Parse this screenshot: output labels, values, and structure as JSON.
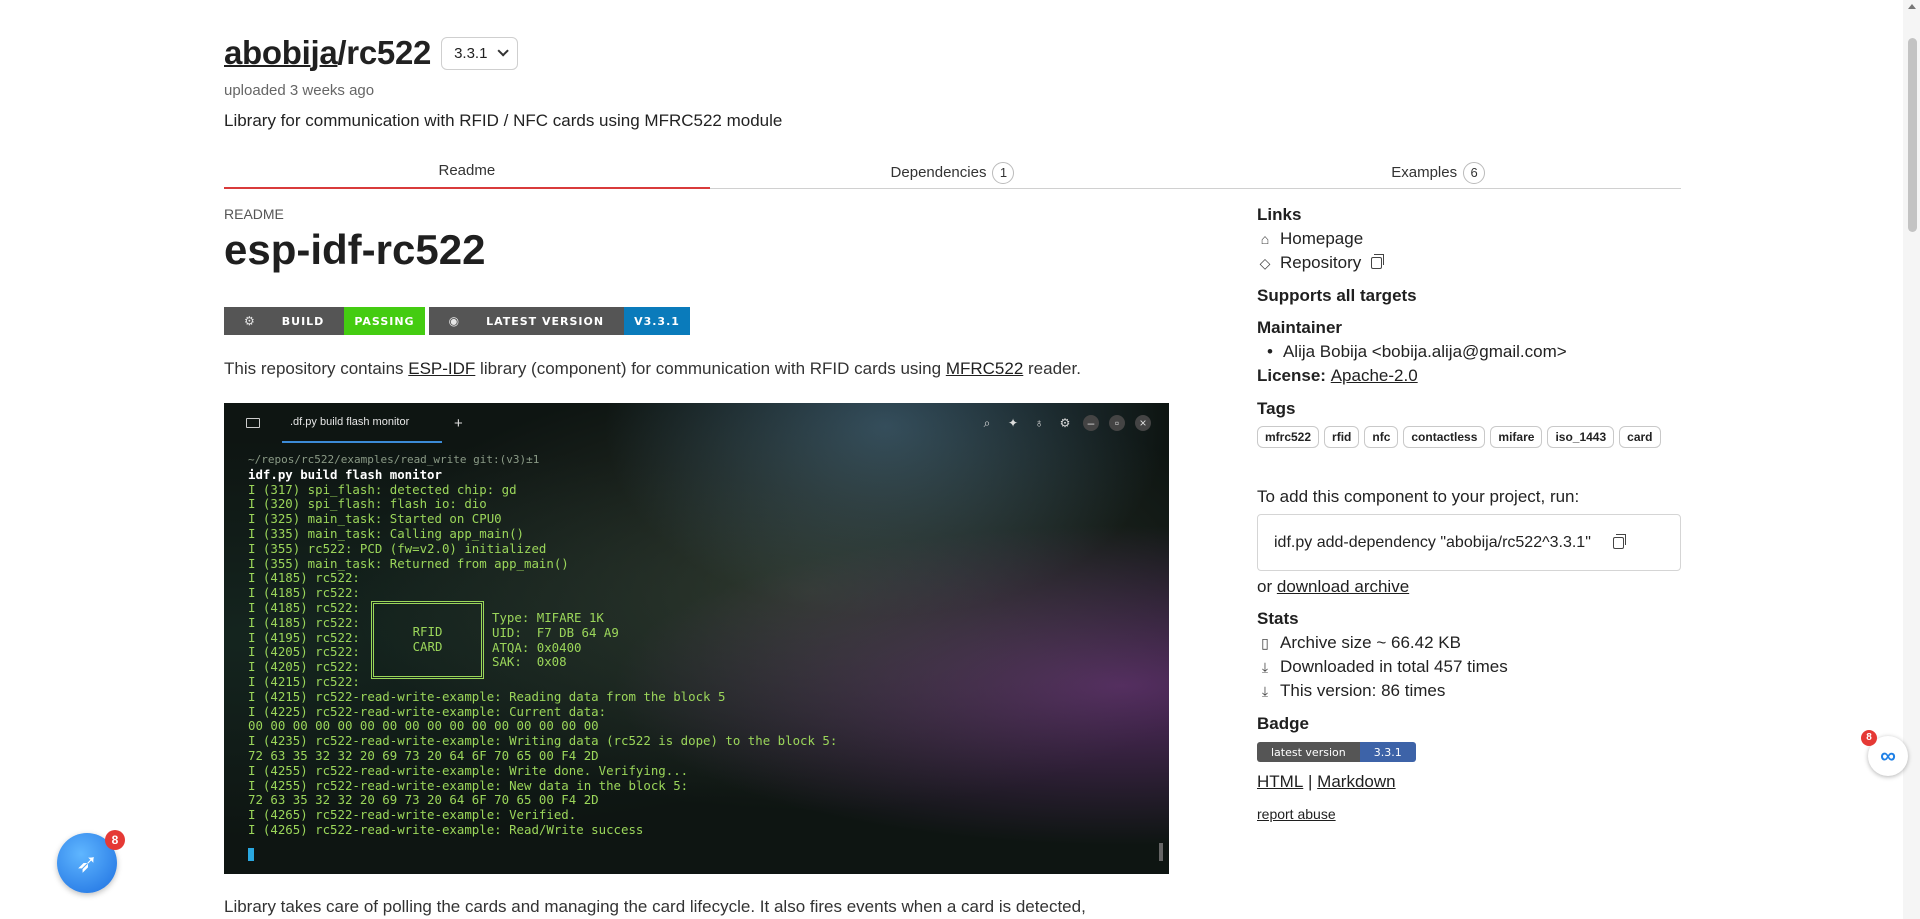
{
  "header": {
    "owner": "abobija",
    "separator": "/",
    "repo": "rc522",
    "version": "3.3.1",
    "uploaded": "uploaded 3 weeks ago",
    "description": "Library for communication with RFID / NFC cards using MFRC522 module"
  },
  "tabs": [
    {
      "label": "Readme",
      "count": null
    },
    {
      "label": "Dependencies",
      "count": "1"
    },
    {
      "label": "Examples",
      "count": "6"
    }
  ],
  "readme": {
    "label": "README",
    "title": "esp-idf-rc522",
    "shields": {
      "build_label": "BUILD",
      "build_value": "PASSING",
      "version_label": "LATEST VERSION",
      "version_value": "V3.3.1"
    },
    "intro_before": "This repository contains ",
    "intro_link1": "ESP-IDF",
    "intro_middle": " library (component) for communication with RFID cards using ",
    "intro_link2": "MFRC522",
    "intro_after": " reader.",
    "bottom_text": "Library takes care of polling the cards and managing the card lifecycle. It also fires events when a card is detected,"
  },
  "terminal": {
    "tab_title": ".df.py build flash monitor",
    "path_line": "~/repos/rc522/examples/read_write git:(v3)±1",
    "command": "idf.py build flash monitor",
    "lines": [
      "I (317) spi_flash: detected chip: gd",
      "I (320) spi_flash: flash io: dio",
      "I (325) main_task: Started on CPU0",
      "I (335) main_task: Calling app_main()",
      "I (355) rc522: PCD (fw=v2.0) initialized",
      "I (355) main_task: Returned from app_main()",
      "I (4185) rc522:",
      "I (4185) rc522:",
      "I (4185) rc522:",
      "I (4185) rc522:",
      "I (4195) rc522:",
      "I (4205) rc522:",
      "I (4205) rc522:",
      "I (4215) rc522:",
      "I (4215) rc522-read-write-example: Reading data from the block 5",
      "I (4225) rc522-read-write-example: Current data:",
      "00 00 00 00 00 00 00 00 00 00 00 00 00 00 00 00",
      "I (4235) rc522-read-write-example: Writing data (rc522 is dope) to the block 5:",
      "72 63 35 32 32 20 69 73 20 64 6F 70 65 00 F4 2D",
      "I (4255) rc522-read-write-example: Write done. Verifying...",
      "I (4255) rc522-read-write-example: New data in the block 5:",
      "72 63 35 32 32 20 69 73 20 64 6F 70 65 00 F4 2D",
      "I (4265) rc522-read-write-example: Verified.",
      "I (4265) rc522-read-write-example: Read/Write success"
    ],
    "card_box": "RFID\nCARD",
    "card_info": "Type: MIFARE 1K\nUID:  F7 DB 64 A9\nATQA: 0x0400\nSAK:  0x08"
  },
  "sidebar": {
    "links_heading": "Links",
    "homepage": "Homepage",
    "repository": "Repository",
    "targets": "Supports all targets",
    "maintainer_heading": "Maintainer",
    "maintainer": "Alija Bobija <bobija.alija@gmail.com>",
    "license_label": "License:",
    "license_value": "Apache-2.0",
    "tags_heading": "Tags",
    "tags": [
      "mfrc522",
      "rfid",
      "nfc",
      "contactless",
      "mifare",
      "iso_1443",
      "card"
    ],
    "add_text": "To add this component to your project, run:",
    "add_command": "idf.py add-dependency \"abobija/rc522^3.3.1\"",
    "or_text": "or",
    "download": "download archive",
    "stats_heading": "Stats",
    "archive_size": "Archive size ~ 66.42 KB",
    "downloaded_total": "Downloaded in total 457 times",
    "this_version": "This version: 86 times",
    "badge_heading": "Badge",
    "badge_left": "latest version",
    "badge_right": "3.3.1",
    "html_link": "HTML",
    "pipe": "|",
    "markdown_link": "Markdown",
    "report": "report abuse"
  },
  "widgets": {
    "left_badge": "8",
    "right_badge": "8"
  }
}
